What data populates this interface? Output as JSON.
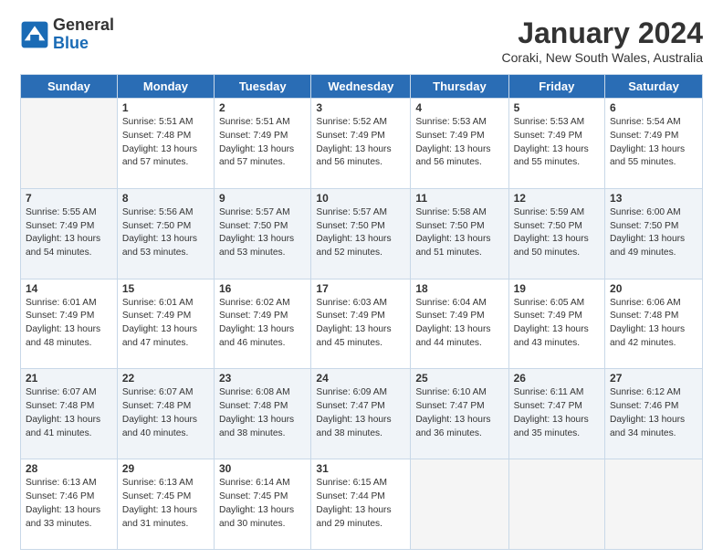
{
  "header": {
    "logo_general": "General",
    "logo_blue": "Blue",
    "month_title": "January 2024",
    "location": "Coraki, New South Wales, Australia"
  },
  "days_of_week": [
    "Sunday",
    "Monday",
    "Tuesday",
    "Wednesday",
    "Thursday",
    "Friday",
    "Saturday"
  ],
  "weeks": [
    [
      {
        "num": "",
        "info": ""
      },
      {
        "num": "1",
        "info": "Sunrise: 5:51 AM\nSunset: 7:48 PM\nDaylight: 13 hours\nand 57 minutes."
      },
      {
        "num": "2",
        "info": "Sunrise: 5:51 AM\nSunset: 7:49 PM\nDaylight: 13 hours\nand 57 minutes."
      },
      {
        "num": "3",
        "info": "Sunrise: 5:52 AM\nSunset: 7:49 PM\nDaylight: 13 hours\nand 56 minutes."
      },
      {
        "num": "4",
        "info": "Sunrise: 5:53 AM\nSunset: 7:49 PM\nDaylight: 13 hours\nand 56 minutes."
      },
      {
        "num": "5",
        "info": "Sunrise: 5:53 AM\nSunset: 7:49 PM\nDaylight: 13 hours\nand 55 minutes."
      },
      {
        "num": "6",
        "info": "Sunrise: 5:54 AM\nSunset: 7:49 PM\nDaylight: 13 hours\nand 55 minutes."
      }
    ],
    [
      {
        "num": "7",
        "info": "Sunrise: 5:55 AM\nSunset: 7:49 PM\nDaylight: 13 hours\nand 54 minutes."
      },
      {
        "num": "8",
        "info": "Sunrise: 5:56 AM\nSunset: 7:50 PM\nDaylight: 13 hours\nand 53 minutes."
      },
      {
        "num": "9",
        "info": "Sunrise: 5:57 AM\nSunset: 7:50 PM\nDaylight: 13 hours\nand 53 minutes."
      },
      {
        "num": "10",
        "info": "Sunrise: 5:57 AM\nSunset: 7:50 PM\nDaylight: 13 hours\nand 52 minutes."
      },
      {
        "num": "11",
        "info": "Sunrise: 5:58 AM\nSunset: 7:50 PM\nDaylight: 13 hours\nand 51 minutes."
      },
      {
        "num": "12",
        "info": "Sunrise: 5:59 AM\nSunset: 7:50 PM\nDaylight: 13 hours\nand 50 minutes."
      },
      {
        "num": "13",
        "info": "Sunrise: 6:00 AM\nSunset: 7:50 PM\nDaylight: 13 hours\nand 49 minutes."
      }
    ],
    [
      {
        "num": "14",
        "info": "Sunrise: 6:01 AM\nSunset: 7:49 PM\nDaylight: 13 hours\nand 48 minutes."
      },
      {
        "num": "15",
        "info": "Sunrise: 6:01 AM\nSunset: 7:49 PM\nDaylight: 13 hours\nand 47 minutes."
      },
      {
        "num": "16",
        "info": "Sunrise: 6:02 AM\nSunset: 7:49 PM\nDaylight: 13 hours\nand 46 minutes."
      },
      {
        "num": "17",
        "info": "Sunrise: 6:03 AM\nSunset: 7:49 PM\nDaylight: 13 hours\nand 45 minutes."
      },
      {
        "num": "18",
        "info": "Sunrise: 6:04 AM\nSunset: 7:49 PM\nDaylight: 13 hours\nand 44 minutes."
      },
      {
        "num": "19",
        "info": "Sunrise: 6:05 AM\nSunset: 7:49 PM\nDaylight: 13 hours\nand 43 minutes."
      },
      {
        "num": "20",
        "info": "Sunrise: 6:06 AM\nSunset: 7:48 PM\nDaylight: 13 hours\nand 42 minutes."
      }
    ],
    [
      {
        "num": "21",
        "info": "Sunrise: 6:07 AM\nSunset: 7:48 PM\nDaylight: 13 hours\nand 41 minutes."
      },
      {
        "num": "22",
        "info": "Sunrise: 6:07 AM\nSunset: 7:48 PM\nDaylight: 13 hours\nand 40 minutes."
      },
      {
        "num": "23",
        "info": "Sunrise: 6:08 AM\nSunset: 7:48 PM\nDaylight: 13 hours\nand 38 minutes."
      },
      {
        "num": "24",
        "info": "Sunrise: 6:09 AM\nSunset: 7:47 PM\nDaylight: 13 hours\nand 38 minutes."
      },
      {
        "num": "25",
        "info": "Sunrise: 6:10 AM\nSunset: 7:47 PM\nDaylight: 13 hours\nand 36 minutes."
      },
      {
        "num": "26",
        "info": "Sunrise: 6:11 AM\nSunset: 7:47 PM\nDaylight: 13 hours\nand 35 minutes."
      },
      {
        "num": "27",
        "info": "Sunrise: 6:12 AM\nSunset: 7:46 PM\nDaylight: 13 hours\nand 34 minutes."
      }
    ],
    [
      {
        "num": "28",
        "info": "Sunrise: 6:13 AM\nSunset: 7:46 PM\nDaylight: 13 hours\nand 33 minutes."
      },
      {
        "num": "29",
        "info": "Sunrise: 6:13 AM\nSunset: 7:45 PM\nDaylight: 13 hours\nand 31 minutes."
      },
      {
        "num": "30",
        "info": "Sunrise: 6:14 AM\nSunset: 7:45 PM\nDaylight: 13 hours\nand 30 minutes."
      },
      {
        "num": "31",
        "info": "Sunrise: 6:15 AM\nSunset: 7:44 PM\nDaylight: 13 hours\nand 29 minutes."
      },
      {
        "num": "",
        "info": ""
      },
      {
        "num": "",
        "info": ""
      },
      {
        "num": "",
        "info": ""
      }
    ]
  ]
}
